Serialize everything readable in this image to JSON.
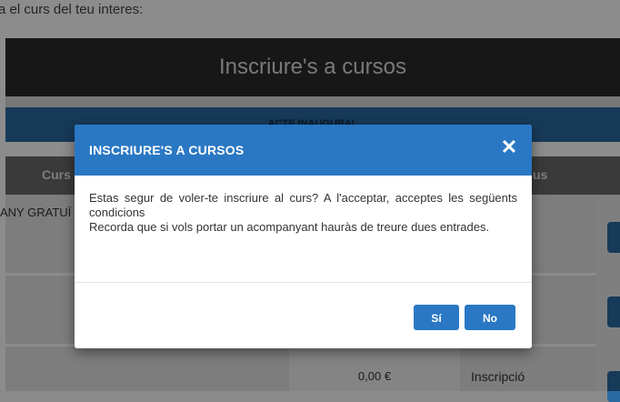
{
  "page": {
    "intro_text": "a el curs del teu interes:",
    "title": "Inscriure's a cursos",
    "band_text": "ACTE INAUGURAL",
    "table": {
      "header_course": "Curs",
      "header_right": "us",
      "row1_course": "ANY GRATUÏ",
      "row3_price": "0,00 €",
      "row3_action": "Inscripció"
    }
  },
  "modal": {
    "title": "INSCRIURE'S A CURSOS",
    "close_symbol": "✕",
    "message_line1": "Estas segur de voler-te inscriure al curs? A l'acceptar, acceptes les següents condicions",
    "message_line2": "Recorda que si vols portar un acompanyant hauràs de treure dues entrades.",
    "yes_label": "Sí",
    "no_label": "No"
  },
  "colors": {
    "accent": "#2a78c4",
    "title_bar": "#2b2b2b",
    "band": "#2a6aa3"
  }
}
